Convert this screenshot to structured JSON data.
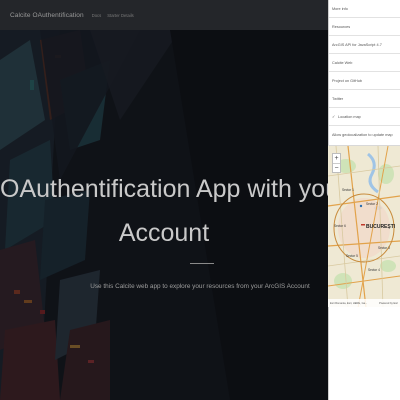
{
  "app": {
    "title": "Calcite OAuthentification",
    "nav": [
      "Docs",
      "Starter Details"
    ]
  },
  "hero": {
    "title_line1": "OAuthentification App with your Ar",
    "title_line2": "Account",
    "subtitle": "Use this Calcite web app to explore your resources from your ArcGIS Account"
  },
  "panel": {
    "header": "More info",
    "items": [
      "Resources",
      "ArcGIS API for JavaScript 4.7",
      "Calcite Web",
      "Project on GitHub",
      "Twitter"
    ],
    "location_toggle": "Location map",
    "geo_note": "Allow geolocalization to update map"
  },
  "map": {
    "zoom_in": "+",
    "zoom_out": "−",
    "city_label": "BUCUREȘTI",
    "sector_labels": [
      "Sector 1",
      "Sector 2",
      "Sector 6",
      "Sector 5",
      "Sector 3",
      "Sector 4"
    ],
    "attribution_left": "Esri Romania, Esri, HERE, Ga...",
    "attribution_right": "Powered by Esri"
  },
  "colors": {
    "hero_bg": "#15181c",
    "topbar": "#26282c",
    "panel_bg": "#ffffff",
    "map_bg": "#eeead8"
  }
}
